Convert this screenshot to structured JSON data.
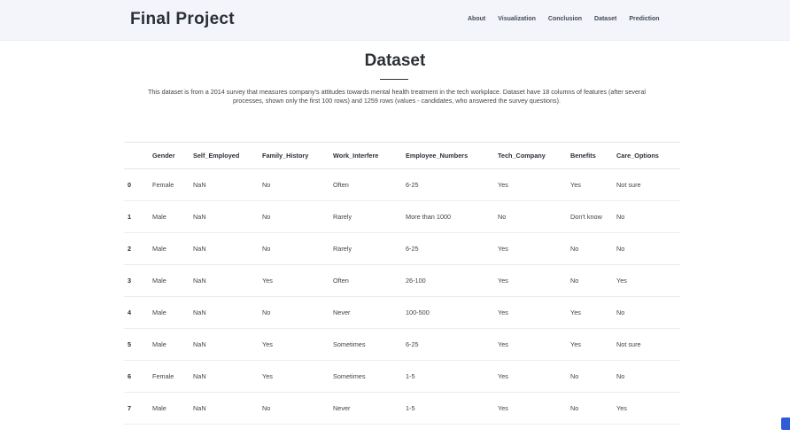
{
  "header": {
    "brand": "Final Project",
    "nav": [
      "About",
      "Visualization",
      "Conclusion",
      "Dataset",
      "Prediction"
    ]
  },
  "main": {
    "title": "Dataset",
    "intro": "This dataset is from a 2014 survey that measures company's attitudes towards mental health treatment in the tech workplace. Dataset have 18 columns of features (after several processes, shown only the first 100 rows) and 1259 rows (values - candidates, who answered the survey questions).",
    "table": {
      "columns": [
        "",
        "Gender",
        "Self_Employed",
        "Family_History",
        "Work_Interfere",
        "Employee_Numbers",
        "Tech_Company",
        "Benefits",
        "Care_Options"
      ],
      "rows": [
        [
          "0",
          "Female",
          "NaN",
          "No",
          "Often",
          "6-25",
          "Yes",
          "Yes",
          "Not sure"
        ],
        [
          "1",
          "Male",
          "NaN",
          "No",
          "Rarely",
          "More than 1000",
          "No",
          "Don't know",
          "No"
        ],
        [
          "2",
          "Male",
          "NaN",
          "No",
          "Rarely",
          "6-25",
          "Yes",
          "No",
          "No"
        ],
        [
          "3",
          "Male",
          "NaN",
          "Yes",
          "Often",
          "26-100",
          "Yes",
          "No",
          "Yes"
        ],
        [
          "4",
          "Male",
          "NaN",
          "No",
          "Never",
          "100-500",
          "Yes",
          "Yes",
          "No"
        ],
        [
          "5",
          "Male",
          "NaN",
          "Yes",
          "Sometimes",
          "6-25",
          "Yes",
          "Yes",
          "Not sure"
        ],
        [
          "6",
          "Female",
          "NaN",
          "Yes",
          "Sometimes",
          "1-5",
          "Yes",
          "No",
          "No"
        ],
        [
          "7",
          "Male",
          "NaN",
          "No",
          "Never",
          "1-5",
          "Yes",
          "No",
          "Yes"
        ]
      ]
    }
  },
  "colors": {
    "header_bg": "#f3f5fb",
    "text_dark": "#2b2f36",
    "widget_blue": "#2f5bd8"
  }
}
